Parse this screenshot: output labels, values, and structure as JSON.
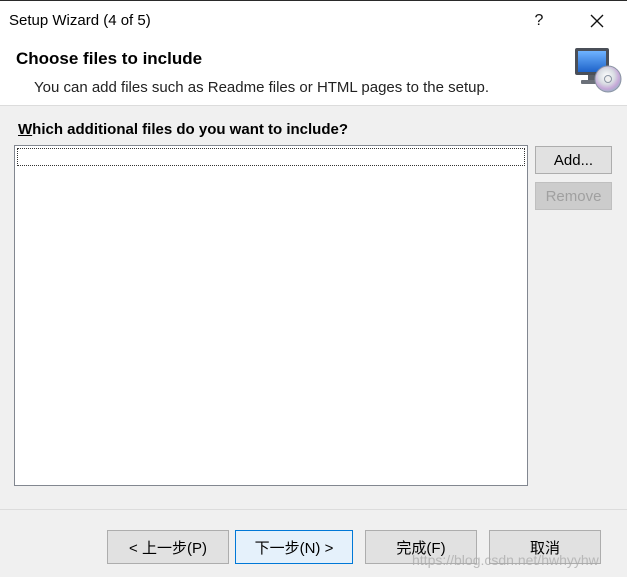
{
  "window": {
    "title": "Setup Wizard (4 of 5)",
    "help_label": "?",
    "close_label": "✕"
  },
  "header": {
    "title": "Choose files to include",
    "subtitle": "You can add files such as Readme files or HTML pages to the setup."
  },
  "files": {
    "label_mnemonic": "W",
    "label_rest": "hich additional files do you want to include?",
    "add_label": "Add...",
    "remove_label": "Remove",
    "remove_enabled": false
  },
  "footer": {
    "back_label": "< 上一步(P)",
    "next_label": "下一步(N) >",
    "finish_label": "完成(F)",
    "cancel_label": "取消"
  },
  "watermark": "https://blog.csdn.net/hwhyyhw",
  "colors": {
    "accent": "#0078d7",
    "disabled_text": "#a0a0a0",
    "dialog_bg": "#f0f0f0"
  },
  "icons": {
    "logo": "computer-with-cd-icon"
  }
}
